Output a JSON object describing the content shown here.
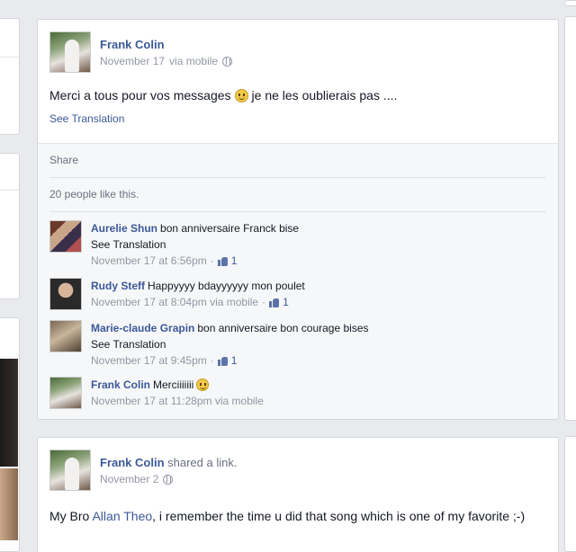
{
  "post1": {
    "author": "Frank Colin",
    "date": "November 17",
    "via": "via mobile",
    "message_before": "Merci a tous pour vos messages",
    "message_after": "je ne les oublierais pas ....",
    "see_translation": "See Translation",
    "share": "Share",
    "likes": "20 people like this.",
    "comments": [
      {
        "author": "Aurelie Shun",
        "text": "bon anniversaire Franck bise",
        "see_translation": "See Translation",
        "time": "November 17 at 6:56pm",
        "like_count": "1"
      },
      {
        "author": "Rudy Steff",
        "text": "Happyyyy bdayyyyyy mon poulet",
        "time": "November 17 at 8:04pm via mobile",
        "like_count": "1"
      },
      {
        "author": "Marie-claude Grapin",
        "text": "bon anniversaire bon courage bises",
        "see_translation": "See Translation",
        "time": "November 17 at 9:45pm",
        "like_count": "1"
      },
      {
        "author": "Frank Colin",
        "text": "Merciiiiiii",
        "time": "November 17 at 11:28pm via mobile"
      }
    ]
  },
  "post2": {
    "author": "Frank Colin",
    "action": "shared a link.",
    "date": "November 2",
    "message_before": "My Bro",
    "link_name": "Allan Theo",
    "message_after": ", i remember the time u did that song which is one of my favorite ;-)"
  },
  "icons": {
    "privacy": "globe-icon",
    "emoticon": "smiley-icon",
    "like": "like-icon"
  },
  "colors": {
    "link_blue": "#3b5998",
    "meta_gray": "#9197a3",
    "background": "#e9eaed"
  }
}
